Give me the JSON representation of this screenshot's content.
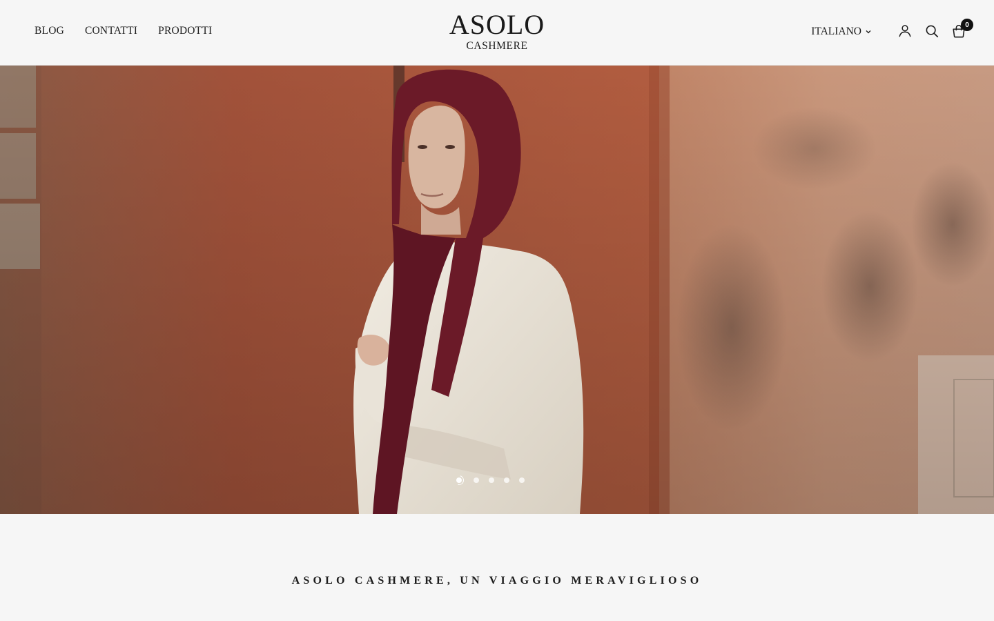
{
  "header": {
    "nav": [
      {
        "label": "BLOG"
      },
      {
        "label": "CONTATTI"
      },
      {
        "label": "PRODOTTI"
      }
    ],
    "logo": {
      "main": "ASOLO",
      "sub": "CASHMERE"
    },
    "language": "ITALIANO",
    "icons": {
      "account": "user-icon",
      "search": "search-icon",
      "cart": "shopping-bag-icon"
    },
    "cart_count": "0"
  },
  "hero": {
    "image": "woman-in-burgundy-knit-hood-scarf-white-shirt-against-terracotta-wall",
    "slides_total": 5,
    "active_slide": 1
  },
  "intro": {
    "tagline": "ASOLO CASHMERE, UN VIAGGIO MERAVIGLIOSO"
  },
  "colors": {
    "background": "#f6f6f6",
    "text": "#1c1c1c",
    "badge": "#111111"
  }
}
